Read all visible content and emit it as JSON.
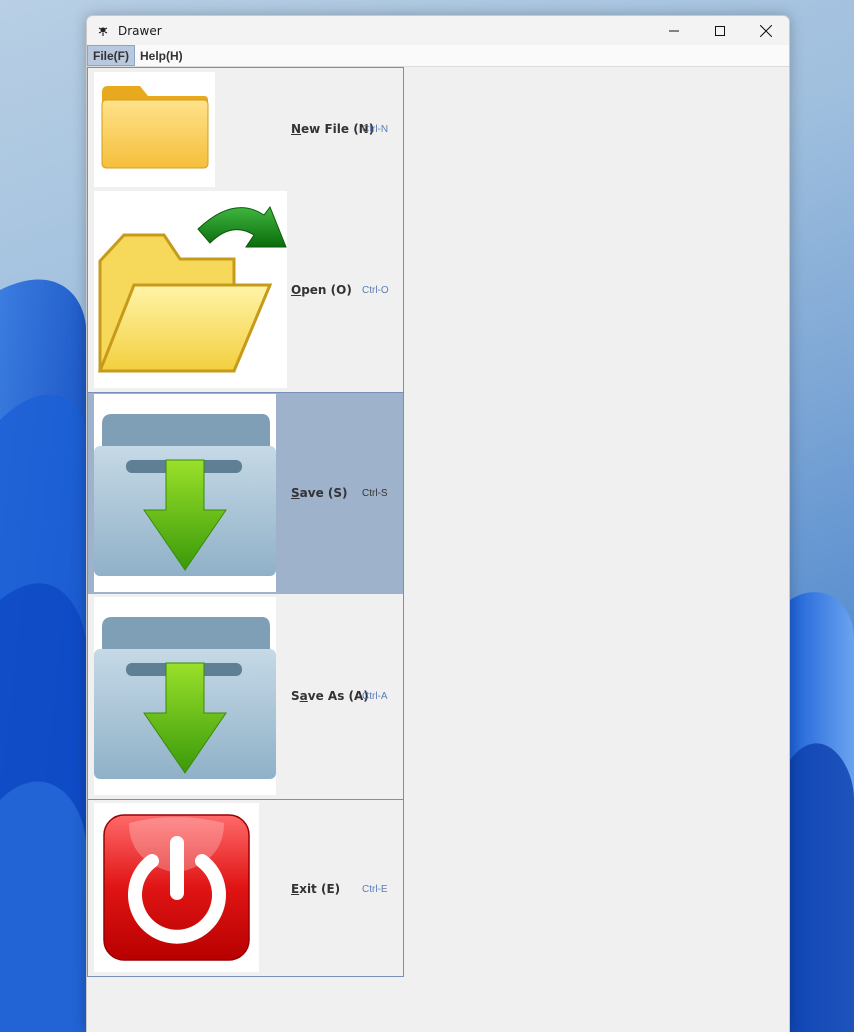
{
  "window": {
    "title": "Drawer"
  },
  "menubar": {
    "items": [
      {
        "label": "File(F)",
        "active": true
      },
      {
        "label": "Help(H)",
        "active": false
      }
    ]
  },
  "file_menu": {
    "items": [
      {
        "mnemonic": "N",
        "rest": "ew File (N)",
        "accelerator": "Ctrl-N",
        "icon": "new-folder-icon",
        "selected": false
      },
      {
        "mnemonic": "O",
        "rest": "pen (O)",
        "accelerator": "Ctrl-O",
        "icon": "open-folder-icon",
        "selected": false
      },
      {
        "mnemonic": "S",
        "rest": "ave (S)",
        "accelerator": "Ctrl-S",
        "icon": "save-icon",
        "selected": true
      },
      {
        "pre": "S",
        "mnemonic": "a",
        "rest": "ve As (A)",
        "accelerator": "Ctrl-A",
        "icon": "save-as-icon",
        "selected": false
      },
      {
        "mnemonic": "E",
        "rest": "xit (E)",
        "accelerator": "Ctrl-E",
        "icon": "power-icon",
        "selected": false
      }
    ]
  },
  "colors": {
    "menu_border": "#7a8fb8",
    "selected_bg": "#9fb2cc",
    "accelerator": "#5a7cb8"
  }
}
